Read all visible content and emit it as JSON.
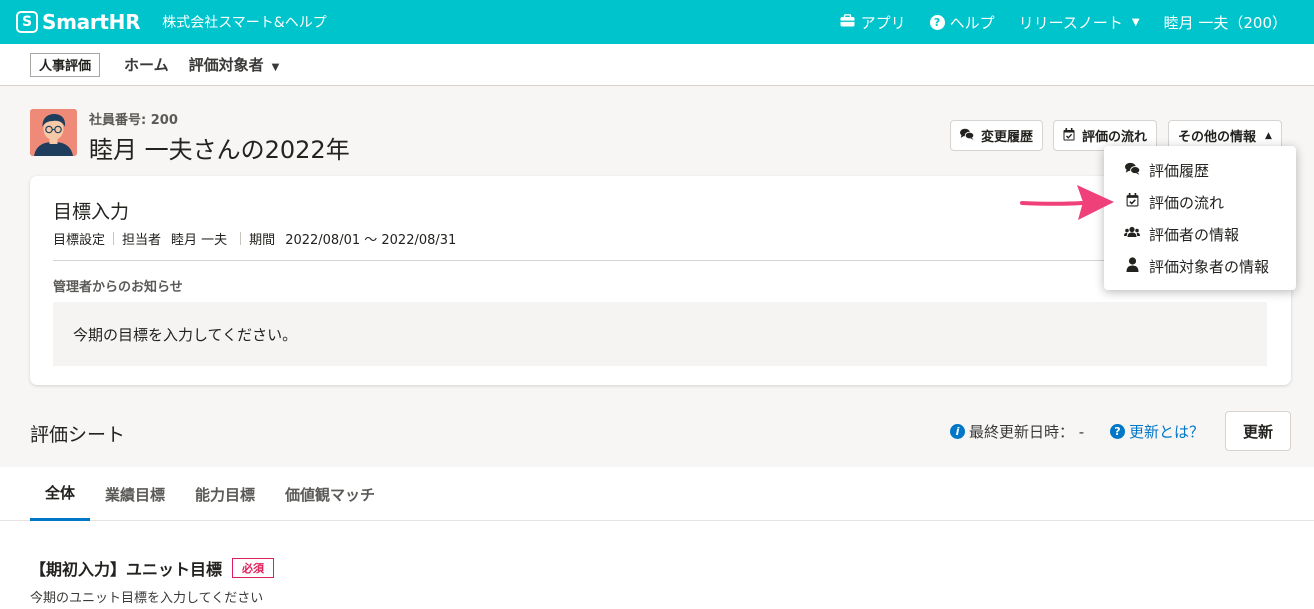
{
  "header": {
    "logo_mark": "S",
    "logo_text": "SmartHR",
    "company": "株式会社スマート&ヘルプ",
    "nav": [
      {
        "label": "アプリ",
        "icon": "toolbox-icon"
      },
      {
        "label": "ヘルプ",
        "icon": "question-icon"
      },
      {
        "label": "リリースノート",
        "icon": "caret-down-icon"
      },
      {
        "label": "睦月 一夫（200）"
      }
    ]
  },
  "appnav": {
    "badge": "人事評価",
    "home": "ホーム",
    "target": "評価対象者"
  },
  "employee": {
    "number_label": "社員番号: 200",
    "title": "睦月 一夫さんの2022年"
  },
  "actions": {
    "history": "変更履歴",
    "flow": "評価の流れ",
    "other": "その他の情報"
  },
  "menu": {
    "items": [
      {
        "label": "評価履歴",
        "icon": "comments-icon"
      },
      {
        "label": "評価の流れ",
        "icon": "calendar-check-icon"
      },
      {
        "label": "評価者の情報",
        "icon": "users-icon"
      },
      {
        "label": "評価対象者の情報",
        "icon": "user-icon"
      }
    ]
  },
  "goal": {
    "title": "目標入力",
    "stage": "目標設定",
    "person_key": "担当者",
    "person": "睦月 一夫",
    "period_key": "期間",
    "period": "2022/08/01 〜 2022/08/31",
    "notice_label": "管理者からのお知らせ",
    "notice": "今期の目標を入力してください。"
  },
  "sheet": {
    "title": "評価シート",
    "last_updated": "最終更新日時： -",
    "what_is_update": "更新とは？",
    "update_button": "更新"
  },
  "tabs": [
    "全体",
    "業績目標",
    "能力目標",
    "価値観マッチ"
  ],
  "section": {
    "title": "【期初入力】ユニット目標",
    "required": "必須",
    "description": "今期のユニット目標を入力してください"
  },
  "colors": {
    "brand": "#00c4cc",
    "link": "#0077c7",
    "required": "#e01e5a",
    "annotation_arrow": "#f0407a"
  }
}
